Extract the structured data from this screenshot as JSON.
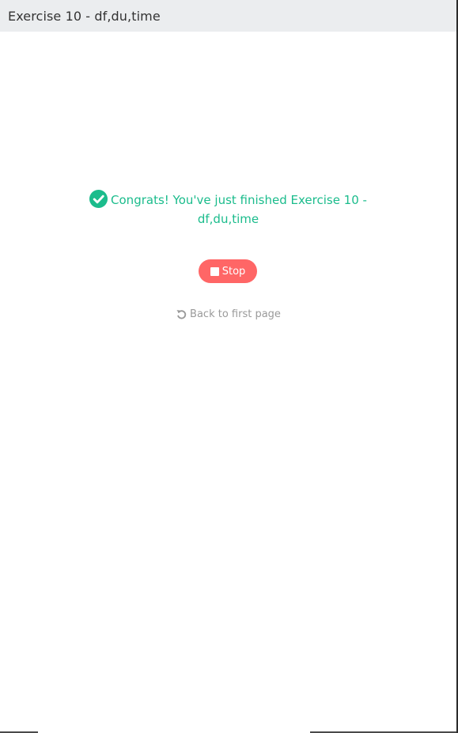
{
  "header": {
    "title": "Exercise 10 - df,du,time"
  },
  "main": {
    "congrats_line1": "Congrats! You've just finished Exercise 10 -",
    "congrats_line2": "df,du,time",
    "congrats_icon": "check-circle-icon",
    "stop_label": "Stop",
    "stop_icon": "stop-square-icon",
    "back_label": "Back to first page",
    "back_icon": "undo-icon"
  },
  "colors": {
    "accent_green": "#1bbc8c",
    "stop_red": "#ff6666",
    "muted_text": "#9a9a9a",
    "header_bg": "#ebedef"
  }
}
